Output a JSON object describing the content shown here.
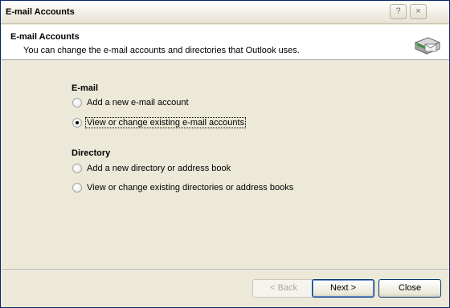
{
  "window": {
    "title": "E-mail Accounts",
    "help_button": "?",
    "close_button": "×"
  },
  "header": {
    "title": "E-mail Accounts",
    "description": "You can change the e-mail accounts and directories that Outlook uses.",
    "icon": "mailbox-book-icon"
  },
  "email_section": {
    "title": "E-mail",
    "options": [
      {
        "label": "Add a new e-mail account",
        "checked": false
      },
      {
        "label": "View or change existing e-mail accounts",
        "checked": true
      }
    ]
  },
  "directory_section": {
    "title": "Directory",
    "options": [
      {
        "label": "Add a new directory or address book",
        "checked": false
      },
      {
        "label": "View or change existing directories or address books",
        "checked": false
      }
    ]
  },
  "buttons": {
    "back": "< Back",
    "next": "Next >",
    "close": "Close"
  }
}
